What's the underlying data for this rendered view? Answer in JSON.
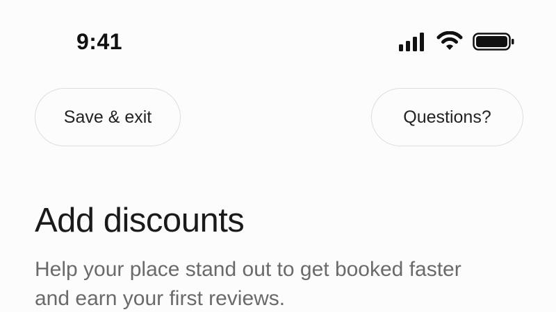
{
  "status_bar": {
    "time": "9:41",
    "icons": [
      "cellular-signal-icon",
      "wifi-icon",
      "battery-icon"
    ]
  },
  "header": {
    "save_exit_label": "Save & exit",
    "questions_label": "Questions?"
  },
  "main": {
    "title": "Add discounts",
    "subtitle": "Help your place stand out to get booked faster and earn your first reviews."
  },
  "colors": {
    "background": "#fdfcfd",
    "title": "#1a1a1a",
    "subtitle": "#6a6a6a",
    "button_border": "#dddddd"
  }
}
